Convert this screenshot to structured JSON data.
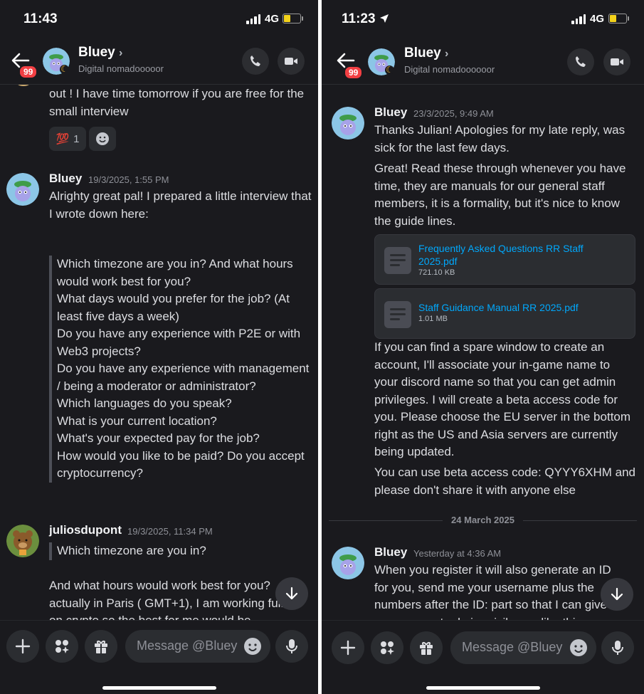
{
  "left": {
    "status": {
      "time": "11:43",
      "network": "4G"
    },
    "header": {
      "badge": "99",
      "name": "Bluey",
      "subtitle": "Digital nomadooooor"
    },
    "messages": {
      "prev_text": "out ! I have time tomorrow if you are free for the small interview",
      "reaction_emoji": "💯",
      "reaction_count": "1",
      "m1": {
        "user": "Bluey",
        "time": "19/3/2025, 1:55 PM",
        "text": "Alrighty great pal! I prepared a little interview that I wrote down here:",
        "quote": [
          "Which timezone are you in? And what hours would work best for you?",
          "What days would you prefer for the job? (At least five days a week)",
          "Do you have any experience with P2E or with Web3 projects?",
          "Do you have any experience with management / being a moderator or administrator?",
          "Which languages do you speak?",
          "What is your current location?",
          "What's your expected pay for the job?",
          "How would you like to be paid? Do you accept cryptocurrency?"
        ]
      },
      "m2": {
        "user": "juliosdupont",
        "time": "19/3/2025, 11:34 PM",
        "quote": "Which timezone are you in?",
        "text1": "And what hours would work best for you?",
        "text2": "actually in Paris ( GMT+1), I am working full",
        "text3": "on crypto so the best for me would be"
      }
    },
    "input": {
      "placeholder": "Message @Bluey"
    }
  },
  "right": {
    "status": {
      "time": "11:23",
      "network": "4G"
    },
    "header": {
      "badge": "99",
      "name": "Bluey",
      "subtitle": "Digital nomadoooooor"
    },
    "messages": {
      "m1": {
        "user": "Bluey",
        "time": "23/3/2025, 9:49 AM",
        "p1": "Thanks Julian! Apologies for my late reply, was sick for the last few days.",
        "p2": "Great! Read these through whenever you have time, they are manuals for our general staff members, it is a formality, but it's nice to know the guide lines.",
        "files": [
          {
            "name": "Frequently Asked Questions RR Staff 2025.pdf",
            "size": "721.10 KB"
          },
          {
            "name": "Staff Guidance Manual RR 2025.pdf",
            "size": "1.01 MB"
          }
        ],
        "p3": "If you can find a spare window to create an account, I'll associate your in-game name to your discord name so that you can get admin privileges. I will create a beta access code for you. Please choose the EU server in the bottom right as the US and Asia servers are currently being updated.",
        "p4": "You can use beta access code: QYYY6XHM and please don't share it with anyone else"
      },
      "date_separator": "24 March 2025",
      "m2": {
        "user": "Bluey",
        "time": "Yesterday at 4:36 AM",
        "text": "When you register it will also generate an ID for you, send me your username plus the numbers after the ID: part so that I can give your account admin privileges, like this"
      }
    },
    "input": {
      "placeholder": "Message @Bluey"
    }
  }
}
